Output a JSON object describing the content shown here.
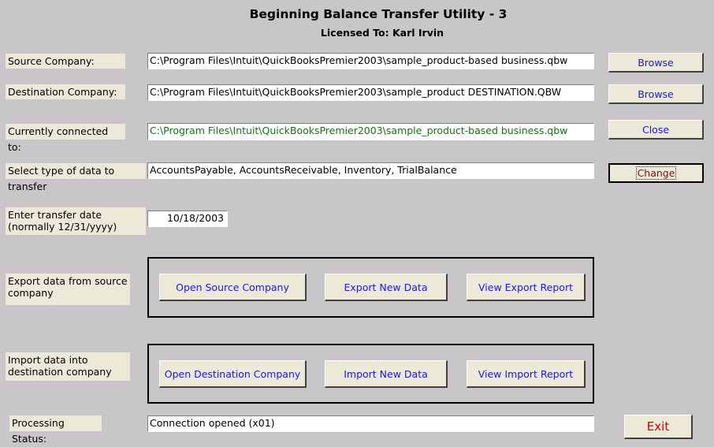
{
  "header": {
    "title": "Beginning Balance Transfer Utility - 3",
    "licensed_to": "Licensed To:  Karl Irvin"
  },
  "source": {
    "label": "Source Company:",
    "value": "C:\\Program Files\\Intuit\\QuickBooksPremier2003\\sample_product-based business.qbw",
    "button": "Browse"
  },
  "destination": {
    "label": "Destination Company:",
    "value": "C:\\Program Files\\Intuit\\QuickBooksPremier2003\\sample_product DESTINATION.QBW",
    "button": "Browse"
  },
  "connected": {
    "label": "Currently connected to:",
    "value": "C:\\Program Files\\Intuit\\QuickBooksPremier2003\\sample_product-based business.qbw",
    "button": "Close",
    "value_color": "#0a7a0a"
  },
  "data_type": {
    "label": "Select type of data to transfer",
    "value": "AccountsPayable, AccountsReceivable, Inventory, TrialBalance",
    "button": "Change"
  },
  "transfer_date": {
    "label": "Enter transfer date (normally 12/31/yyyy)",
    "value": "10/18/2003"
  },
  "export": {
    "label": "Export data from source company",
    "buttons": [
      "Open Source Company",
      "Export New Data",
      "View Export Report"
    ]
  },
  "import": {
    "label": "Import  data into destination  company",
    "buttons": [
      "Open Destination  Company",
      "Import New Data",
      "View Import Report"
    ]
  },
  "status": {
    "label": "Processing Status:",
    "value": "Connection opened (x01)"
  },
  "exit_button": "Exit",
  "colors": {
    "background": "#c8c6c8",
    "label_bg": "#ece9d8",
    "button_text": "#1a1adc",
    "exit_text": "#d00000"
  }
}
